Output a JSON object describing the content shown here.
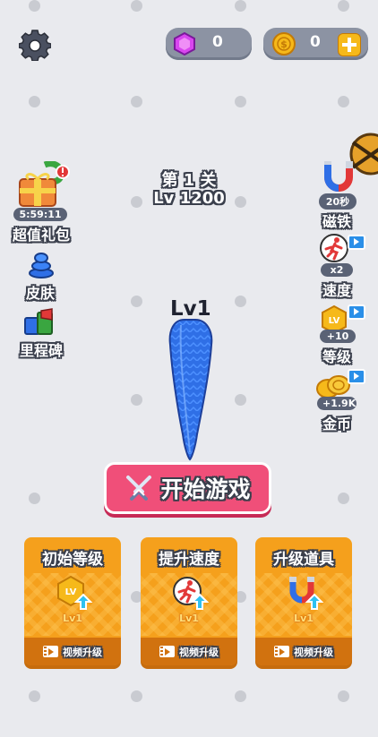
{
  "topbar": {
    "settings_icon": "gear-icon",
    "gems": {
      "icon": "pink-gem-icon",
      "value": "0"
    },
    "coins": {
      "icon": "gold-coin-icon",
      "value": "0",
      "add_icon": "plus-icon"
    }
  },
  "level": {
    "stage": "第 1 关",
    "length": "Lv 1200"
  },
  "snake": {
    "level_label": "Lv1",
    "color": "#2f6fe6"
  },
  "left_menu": [
    {
      "label": "超值礼包",
      "timer": "5:59:11",
      "icon": "gift-snake-icon"
    },
    {
      "label": "皮肤",
      "icon": "snake-skin-icon"
    },
    {
      "label": "里程碑",
      "icon": "milestone-icon"
    }
  ],
  "right_menu": [
    {
      "label": "磁铁",
      "badge": "20秒",
      "icon": "magnet-icon"
    },
    {
      "label": "速度",
      "badge": "x2",
      "icon": "running-icon"
    },
    {
      "label": "等级",
      "badge": "+10",
      "icon": "level-badge-icon"
    },
    {
      "label": "金币",
      "badge": "+1.9K",
      "icon": "coins-icon"
    }
  ],
  "start_button": {
    "label": "开始游戏",
    "icon": "crossed-swords-icon"
  },
  "upgrades": [
    {
      "title": "初始等级",
      "level": "Lv1",
      "button": "视频升级",
      "icon": "level-up-icon"
    },
    {
      "title": "提升速度",
      "level": "Lv1",
      "button": "视频升级",
      "icon": "speed-up-icon"
    },
    {
      "title": "升级道具",
      "level": "Lv1",
      "button": "视频升级",
      "icon": "magnet-up-icon"
    }
  ],
  "colors": {
    "background": "#e9eaee",
    "start_button": "#f04f79",
    "card": "#f5a01c",
    "snake": "#2f6fe6"
  }
}
